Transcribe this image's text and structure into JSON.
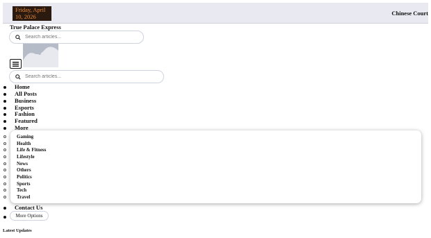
{
  "topbar": {
    "date": "Friday, April 10, 2026",
    "right_link": "Chinese Court"
  },
  "site": {
    "title": "True Palace Express"
  },
  "search": {
    "placeholder": "Search articles..."
  },
  "search_secondary": {
    "placeholder": "Search articles..."
  },
  "icons": {
    "search": "search-icon",
    "menu": "hamburger-menu-icon",
    "logo": "image-placeholder-icon"
  },
  "nav": {
    "items": [
      {
        "label": "Home"
      },
      {
        "label": "All Posts"
      },
      {
        "label": "Business"
      },
      {
        "label": "Esports"
      },
      {
        "label": "Fashion"
      },
      {
        "label": "Featured"
      },
      {
        "label": "More"
      }
    ],
    "submenu": [
      {
        "label": "Gaming"
      },
      {
        "label": "Health"
      },
      {
        "label": "Life & Fitness"
      },
      {
        "label": "Lifestyle"
      },
      {
        "label": "News"
      },
      {
        "label": "Others"
      },
      {
        "label": "Politics"
      },
      {
        "label": "Sports"
      },
      {
        "label": "Tech"
      },
      {
        "label": "Travel"
      }
    ],
    "contact": "Contact Us",
    "more_options": "More Options"
  },
  "sections": {
    "latest_updates": "Latest Updates"
  },
  "colors": {
    "topbar_bg": "#e9e9f1",
    "date_bg": "#2a1a0f",
    "date_text": "#e98a3a"
  }
}
